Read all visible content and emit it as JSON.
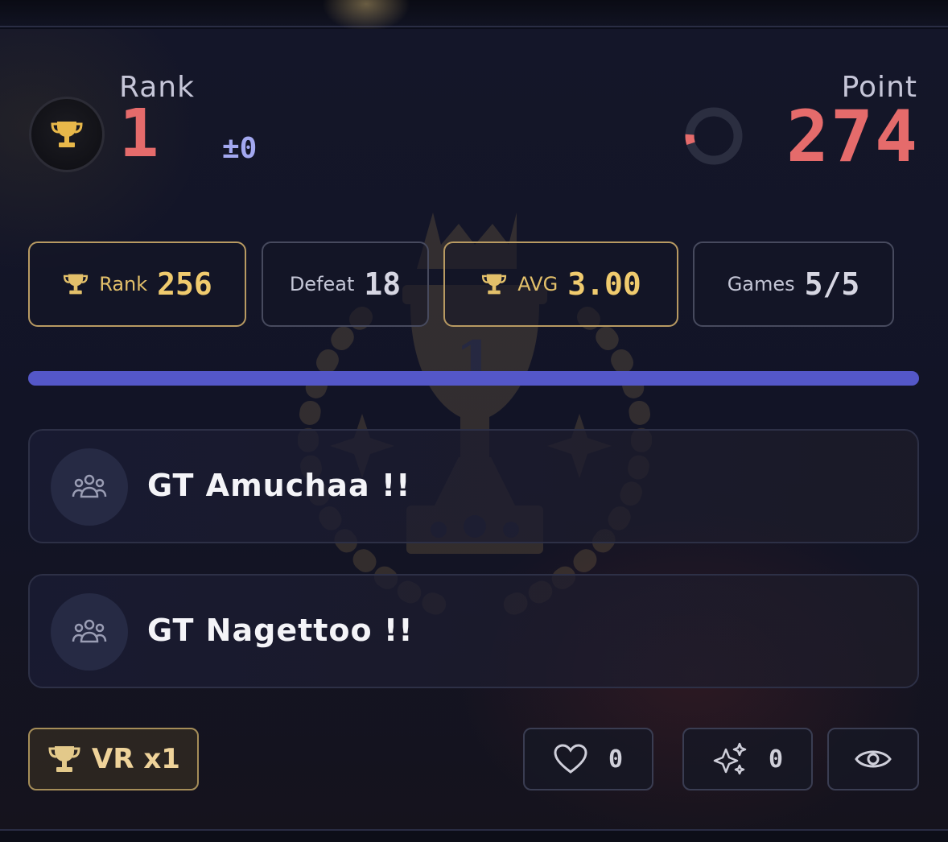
{
  "header": {
    "rank_label": "Rank",
    "rank_value": "1",
    "rank_delta": "±0",
    "point_label": "Point",
    "point_value": "274",
    "point_ring_level": 0.06
  },
  "stats": [
    {
      "label": "Rank",
      "value": "256",
      "icon": "trophy-icon",
      "accent": "gold"
    },
    {
      "label": "Defeat",
      "value": "18",
      "icon": "",
      "accent": "gray"
    },
    {
      "label": "AVG",
      "value": "3.00",
      "icon": "trophy-icon",
      "accent": "gold"
    },
    {
      "label": "Games",
      "value": "5/5",
      "icon": "",
      "accent": "gray"
    }
  ],
  "progress": {
    "fraction": 1.0,
    "color": "#5457c8"
  },
  "teams": [
    {
      "name": "GT Amuchaa !!",
      "icon": "group-icon"
    },
    {
      "name": "GT Nagettoo !!",
      "icon": "group-icon"
    }
  ],
  "footer": {
    "vr_label": "VR x1",
    "likes": "0",
    "sparkles": "0"
  },
  "colors": {
    "accent_red": "#e56b6b",
    "accent_gold": "#f0cb6e",
    "accent_purple": "#5457c8",
    "background": "#121426"
  }
}
